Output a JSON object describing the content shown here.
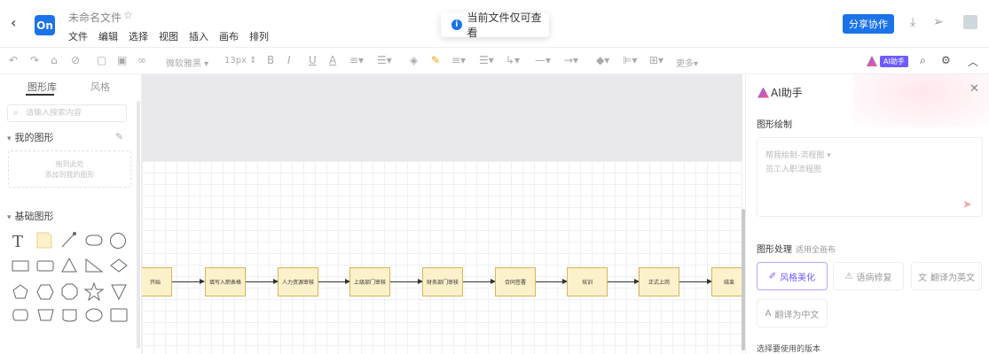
{
  "titlebar": {
    "back_icon": "‹",
    "logo_text": "On",
    "doc_title": "未命名文件",
    "star_icon": "☆",
    "menu": [
      "文件",
      "编辑",
      "选择",
      "视图",
      "插入",
      "画布",
      "排列"
    ],
    "notice": "当前文件仅可查看",
    "share_label": "分享协作"
  },
  "toolbar": {
    "font_family": "微软雅黑",
    "font_size": "13px",
    "more_label": "更多",
    "ai_badge": "AI助手"
  },
  "left_panel": {
    "tabs": [
      "图形库",
      "风格"
    ],
    "search_placeholder": "请输入搜索内容",
    "my_shapes_title": "我的图形",
    "drop_hint_line1": "拖到此处",
    "drop_hint_line2": "添加到我的图形",
    "basic_shapes_title": "基础图形",
    "text_shape": "T"
  },
  "flow": {
    "nodes": [
      "开始",
      "填写入职表格",
      "人力资源审核",
      "上级部门审核",
      "财务部门审核",
      "合同签署",
      "培训",
      "正式上岗",
      "结束"
    ]
  },
  "ai_panel": {
    "title": "AI助手",
    "close_icon": "✕",
    "draw_label": "图形绘制",
    "prompt_type": "帮我绘制-流程图 ▾",
    "prompt_text": "员工入职流程图",
    "send_icon": "➤",
    "process_label": "图形处理",
    "process_hint": "适用全画布",
    "buttons": {
      "beautify": "风格美化",
      "fix": "语病修复",
      "translate_en": "翻译为英文",
      "translate_zh": "翻译为中文"
    },
    "version_label": "选择要使用的版本"
  },
  "colors": {
    "accent": "#1a73e8",
    "node_fill": "#fdf1cc",
    "node_border": "#d6b656",
    "ai_purple": "#6f5bff"
  }
}
